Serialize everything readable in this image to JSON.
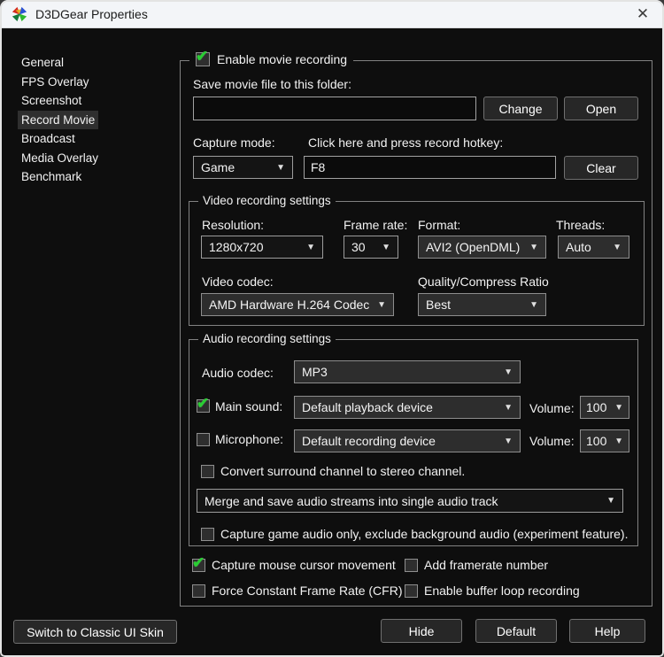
{
  "window": {
    "title": "D3DGear Properties",
    "close_glyph": "✕"
  },
  "icons": {
    "dropdown_arrow": "▼"
  },
  "colors": {
    "accent_check_green": "#29cd33",
    "titlebar_bg": "#f3f5f8",
    "body_bg": "#0e0e0e",
    "selected_item_bg": "#2f2f2f"
  },
  "sidebar": {
    "items": [
      {
        "label": "General",
        "selected": false
      },
      {
        "label": "FPS Overlay",
        "selected": false
      },
      {
        "label": "Screenshot",
        "selected": false
      },
      {
        "label": "Record Movie",
        "selected": true
      },
      {
        "label": "Broadcast",
        "selected": false
      },
      {
        "label": "Media Overlay",
        "selected": false
      },
      {
        "label": "Benchmark",
        "selected": false
      }
    ]
  },
  "main": {
    "enable_group": {
      "label": "Enable movie recording",
      "checked": true
    },
    "save_folder_label": "Save movie file to this folder:",
    "folder_value": "",
    "change_button": "Change",
    "open_button": "Open",
    "capture_mode_label": "Capture mode:",
    "capture_mode_value": "Game",
    "hotkey_label": "Click here and press record hotkey:",
    "hotkey_value": "F8",
    "clear_button": "Clear",
    "video_group": {
      "title": "Video recording settings",
      "resolution_label": "Resolution:",
      "resolution_value": "1280x720",
      "framerate_label": "Frame rate:",
      "framerate_value": "30",
      "format_label": "Format:",
      "format_value": "AVI2 (OpenDML)",
      "threads_label": "Threads:",
      "threads_value": "Auto",
      "video_codec_label": "Video codec:",
      "video_codec_value": "AMD Hardware H.264 Codec",
      "quality_label": "Quality/Compress Ratio",
      "quality_value": "Best"
    },
    "audio_group": {
      "title": "Audio recording settings",
      "audio_codec_label": "Audio codec:",
      "audio_codec_value": "MP3",
      "main_sound": {
        "label": "Main sound:",
        "checked": true,
        "value": "Default playback device"
      },
      "microphone": {
        "label": "Microphone:",
        "checked": false,
        "value": "Default recording device"
      },
      "volume_label": "Volume:",
      "main_volume_value": "100",
      "mic_volume_value": "100",
      "convert_surround": {
        "label": "Convert surround channel to stereo channel.",
        "checked": false
      },
      "merge_value": "Merge and save audio streams into single audio track",
      "capture_game_audio": {
        "label": "Capture game audio only, exclude background audio (experiment feature).",
        "checked": false
      }
    },
    "bottom_checks": {
      "cursor": {
        "label": "Capture mouse cursor movement",
        "checked": true
      },
      "add_framerate": {
        "label": "Add framerate number",
        "checked": false
      },
      "cfr": {
        "label": "Force Constant Frame Rate (CFR)",
        "checked": false
      },
      "buffer_loop": {
        "label": "Enable buffer loop recording",
        "checked": false
      }
    }
  },
  "footer": {
    "classic_skin_button": "Switch to Classic UI Skin",
    "hide_button": "Hide",
    "default_button": "Default",
    "help_button": "Help"
  }
}
